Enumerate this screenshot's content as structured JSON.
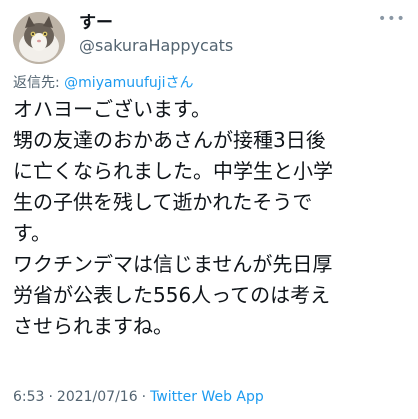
{
  "author": {
    "display_name": "すー",
    "handle": "@sakuraHappycats",
    "avatar_icon": "cat-avatar-icon"
  },
  "menu": {
    "more_icon": "more-dots-icon"
  },
  "reply": {
    "prefix": "返信先: ",
    "mention": "@miyamuufujiさん"
  },
  "tweet": {
    "lines": [
      "オハヨーございます。",
      "甥の友達のおかあさんが接種3日後",
      "に亡くなられました。中学生と小学",
      "生の子供を残して逝かれたそうで",
      "す。",
      "ワクチンデマは信じませんが先日厚",
      "労省が公表した556人ってのは考え",
      "させられますね。"
    ]
  },
  "meta": {
    "time": "6:53",
    "separator": "·",
    "date": "2021/07/16",
    "source": "Twitter Web App"
  },
  "colors": {
    "text": "#0f1419",
    "secondary": "#536471",
    "link": "#1d9bf0"
  }
}
